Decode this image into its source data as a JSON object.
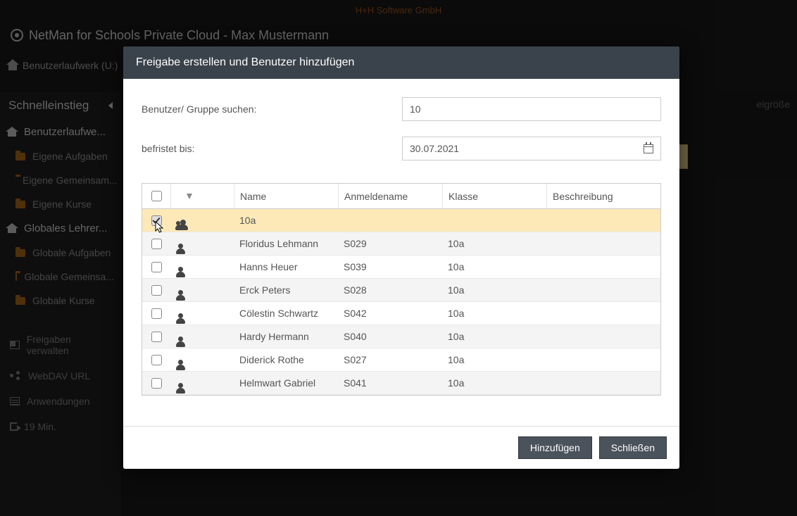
{
  "company": "H+H Software GmbH",
  "app_title": "NetMan for Schools Private Cloud - Max Mustermann",
  "breadcrumb": "Benutzerlaufwerk (U:)",
  "right_header_fragment": "eigröße",
  "sidebar": {
    "heading": "Schnelleinstieg",
    "groups": [
      {
        "label": "Benutzerlaufwe...",
        "type": "home"
      },
      {
        "label": "Eigene Aufgaben",
        "type": "folder"
      },
      {
        "label": "Eigene Gemeinsam...",
        "type": "folder"
      },
      {
        "label": "Eigene Kurse",
        "type": "folder"
      },
      {
        "label": "Globales Lehrer...",
        "type": "home"
      },
      {
        "label": "Globale Aufgaben",
        "type": "folder"
      },
      {
        "label": "Globale Gemeinsa...",
        "type": "folder"
      },
      {
        "label": "Globale Kurse",
        "type": "folder"
      }
    ],
    "utils": [
      {
        "label": "Freigaben verwalten",
        "icon": "grid"
      },
      {
        "label": "WebDAV URL",
        "icon": "share"
      },
      {
        "label": "Anwendungen",
        "icon": "cal"
      },
      {
        "label": "19 Min.",
        "icon": "logout"
      }
    ]
  },
  "modal": {
    "title": "Freigabe erstellen und Benutzer hinzufügen",
    "search_label": "Benutzer/ Gruppe suchen:",
    "search_value": "10",
    "date_label": "befristet bis:",
    "date_value": "30.07.2021",
    "columns": {
      "name": "Name",
      "login": "Anmeldename",
      "class": "Klasse",
      "desc": "Beschreibung"
    },
    "rows": [
      {
        "checked": true,
        "type": "group",
        "name": "10a",
        "login": "",
        "class": "",
        "desc": ""
      },
      {
        "checked": false,
        "type": "user",
        "name": "Floridus Lehmann",
        "login": "S029",
        "class": "10a",
        "desc": ""
      },
      {
        "checked": false,
        "type": "user",
        "name": "Hanns Heuer",
        "login": "S039",
        "class": "10a",
        "desc": ""
      },
      {
        "checked": false,
        "type": "user",
        "name": "Erck Peters",
        "login": "S028",
        "class": "10a",
        "desc": ""
      },
      {
        "checked": false,
        "type": "user",
        "name": "Cölestin Schwartz",
        "login": "S042",
        "class": "10a",
        "desc": ""
      },
      {
        "checked": false,
        "type": "user",
        "name": "Hardy Hermann",
        "login": "S040",
        "class": "10a",
        "desc": ""
      },
      {
        "checked": false,
        "type": "user",
        "name": "Diderick Rothe",
        "login": "S027",
        "class": "10a",
        "desc": ""
      },
      {
        "checked": false,
        "type": "user",
        "name": "Helmwart Gabriel",
        "login": "S041",
        "class": "10a",
        "desc": ""
      }
    ],
    "add_label": "Hinzufügen",
    "close_label": "Schließen"
  }
}
